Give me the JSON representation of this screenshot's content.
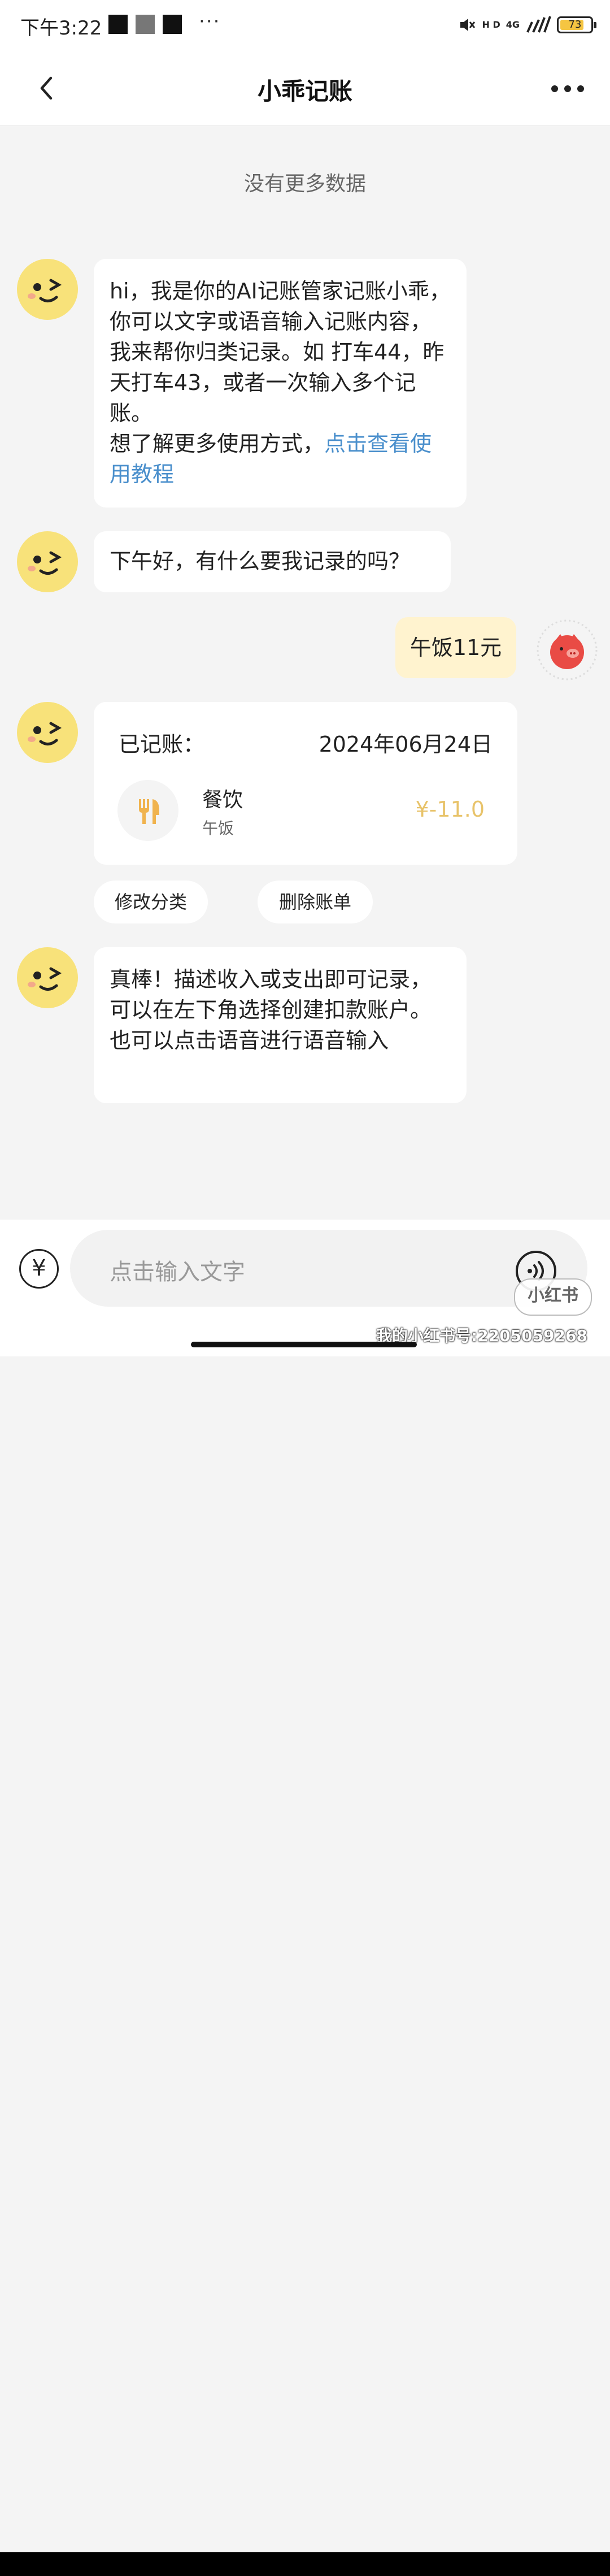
{
  "status_bar": {
    "time": "下午3:22",
    "more": "···",
    "network": "4G",
    "hd": "H D",
    "battery": "73"
  },
  "header": {
    "title": "小乖记账"
  },
  "chat": {
    "no_more": "没有更多数据",
    "messages": [
      {
        "text": "hi，我是你的AI记账管家记账小乖，你可以文字或语音输入记账内容，我来帮你归类记录。如 打车44，昨天打车43，或者一次输入多个记账。",
        "line2": "想了解更多使用方式，",
        "link": "点击查看使用教程"
      },
      {
        "text": "下午好，有什么要我记录的吗？"
      },
      {
        "user_text": "午饭11元"
      },
      {
        "text": "真棒！描述收入或支出即可记录，可以在左下角选择创建扣款账户。也可以点击语音进行语音输入"
      }
    ],
    "record": {
      "label": "已记账：",
      "date": "2024年06月24日",
      "category": "餐饮",
      "note": "午饭",
      "amount": "¥-11.0"
    },
    "actions": {
      "modify": "修改分类",
      "delete": "删除账单"
    }
  },
  "input_bar": {
    "yen": "¥",
    "placeholder": "点击输入文字"
  },
  "watermark": {
    "badge": "小红书",
    "id": "我的小红书号:2205059268"
  },
  "colors": {
    "accent_yellow": "#f5d94a",
    "link_blue": "#4a8fcc",
    "amount_gold": "#e8c36a",
    "user_bubble": "#fff3cf"
  }
}
